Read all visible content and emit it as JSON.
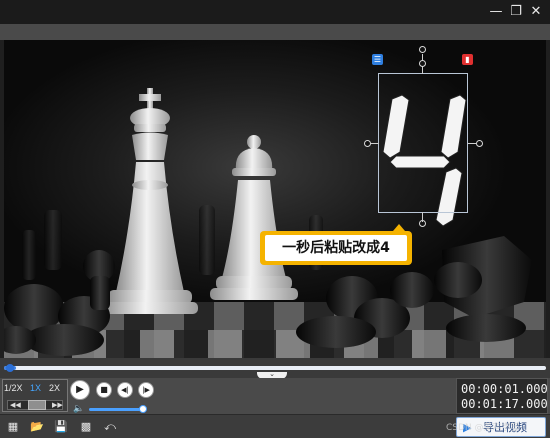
{
  "window": {
    "minimize_icon": "minimize-icon",
    "restore_icon": "restore-icon",
    "close_icon": "close-icon"
  },
  "overlay": {
    "digit": "4",
    "list_badge_icon": "list-icon",
    "delete_badge_icon": "trash-icon",
    "callout_text": "一秒后粘贴改成4",
    "accent_color": "#f5b300"
  },
  "playback": {
    "speeds": [
      "1/2X",
      "1X",
      "2X"
    ],
    "active_speed": "1X",
    "progress_fraction": 0.0588,
    "volume_fraction": 1.0,
    "current_time": "00:00:01.000",
    "total_time": "00:01:17.000"
  },
  "toolbar": {
    "export_label": "导出视频",
    "icons": [
      "project-icon",
      "open-folder-icon",
      "save-icon",
      "save-as-icon",
      "share-icon"
    ]
  },
  "watermark": "CSDN @菜鸡学堂"
}
